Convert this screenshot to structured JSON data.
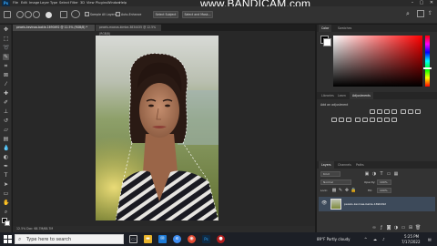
{
  "app": {
    "logo": "Ps",
    "watermark": "www.BANDICAM.com",
    "menu": [
      "File",
      "Edit",
      "Image",
      "Layer",
      "Type",
      "Select",
      "Filter",
      "3D",
      "View",
      "Plugins",
      "Window",
      "Help"
    ]
  },
  "options_bar": {
    "select_subject": "Select Subject",
    "refine_mask": "Select and Mask...",
    "sample_all_layers": "Sample All Layers",
    "auto_enhance": "Auto-Enhance"
  },
  "document": {
    "tabs": [
      {
        "label": "pexels-kevinaa-bakle-1690492 @ 12.5% (RGB/8) *"
      },
      {
        "label": "pexels-maeva-kimbe-3834435 @ 12.5% (RGB/8)"
      }
    ],
    "status": "12.5%    Doc: 68.7M/68.7M"
  },
  "panels": {
    "color": {
      "tabs": [
        "Color",
        "Swatches"
      ]
    },
    "adjustments": {
      "tabs": [
        "Libraries",
        "Learn",
        "Adjustments"
      ],
      "hint": "Add an adjustment"
    },
    "layers": {
      "tabs": [
        "Layers",
        "Channels",
        "Paths"
      ],
      "kind_label": "Kind",
      "blend_mode": "Normal",
      "opacity_label": "Opacity:",
      "opacity": "100%",
      "lock_label": "Lock:",
      "fill_label": "Fill:",
      "fill": "100%",
      "items": [
        {
          "name": "pexels-kevinaa-bakle-1690492"
        }
      ]
    }
  },
  "taskbar": {
    "search_placeholder": "Type here to search",
    "weather": "89°F  Partly cloudy",
    "time": "5:25 PM",
    "date": "7/17/2022"
  }
}
